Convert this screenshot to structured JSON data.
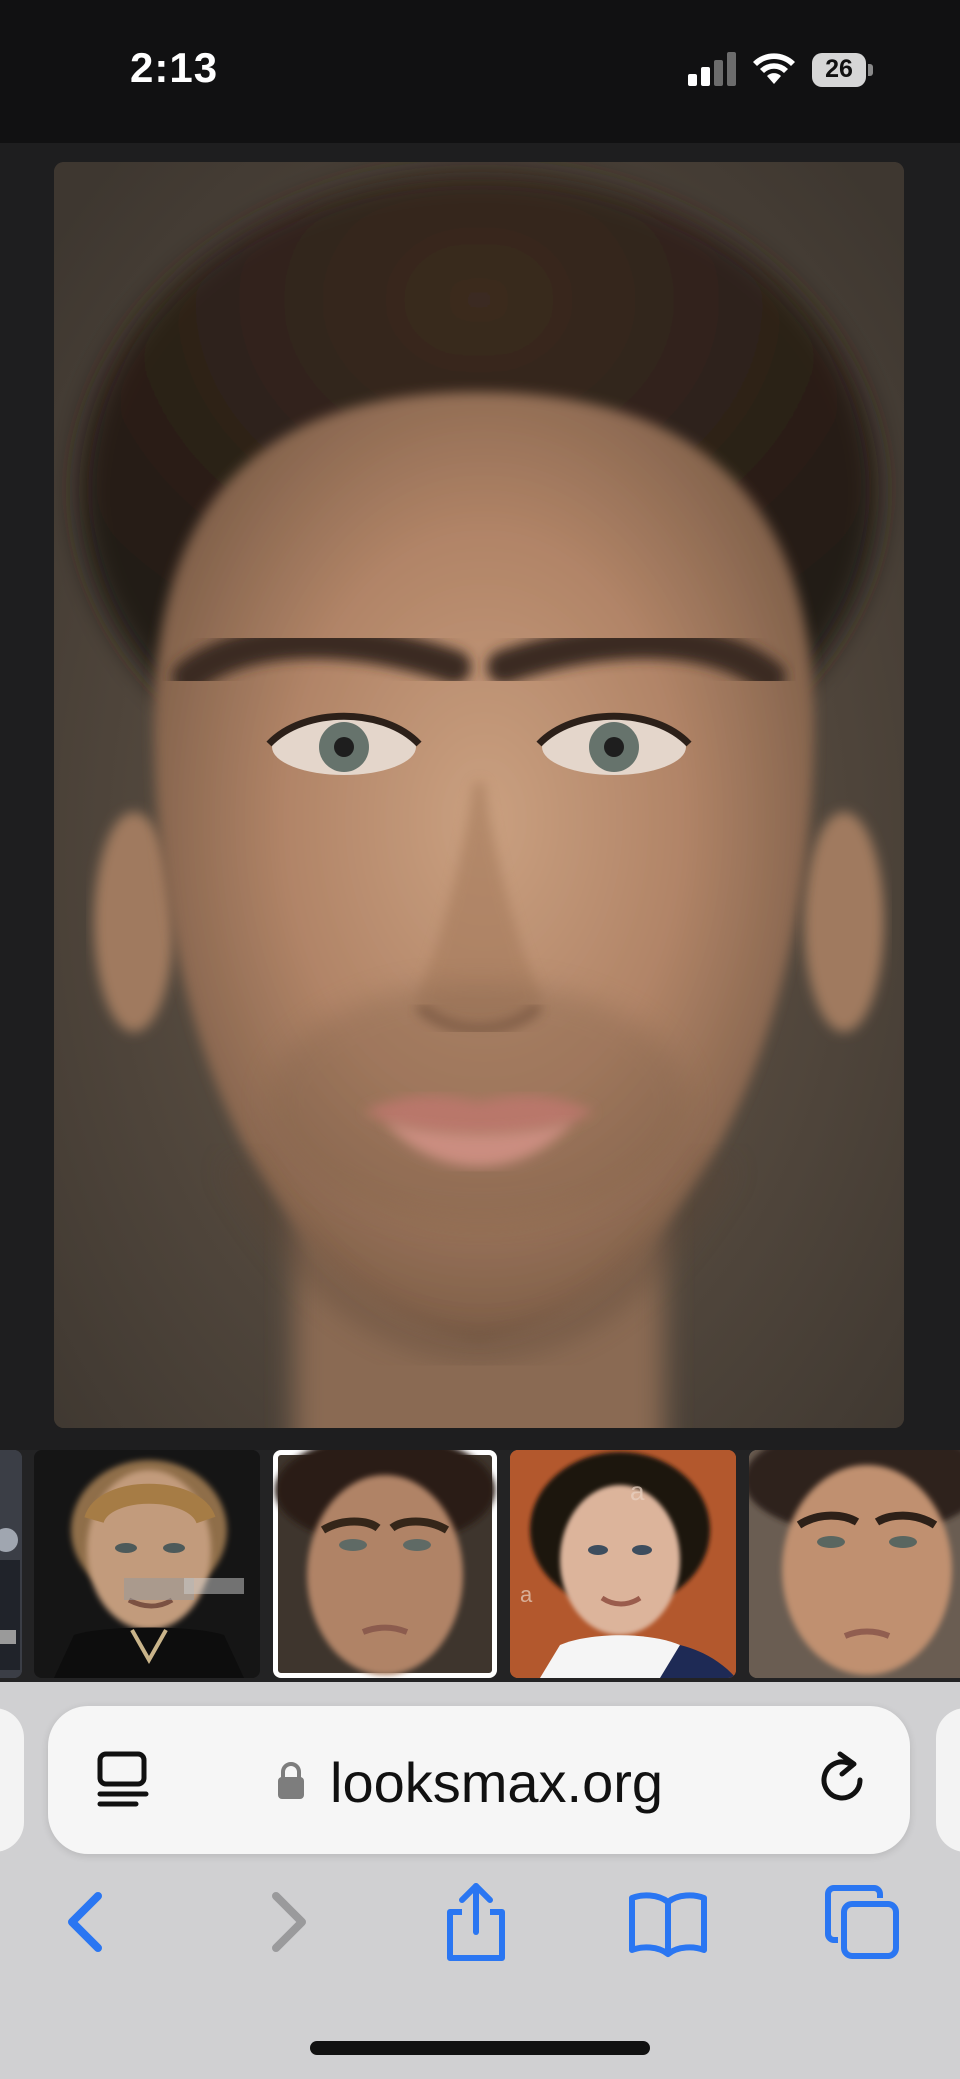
{
  "status": {
    "time": "2:13",
    "battery": "26"
  },
  "browser": {
    "url": "looksmax.org",
    "accent_color": "#2a76f2"
  },
  "thumbnails": [
    {
      "name": "partial-photo"
    },
    {
      "name": "celebrity-photo",
      "watermark": "gettyimages"
    },
    {
      "name": "composite-face",
      "selected": true
    },
    {
      "name": "young-man-photo",
      "watermark": "a"
    },
    {
      "name": "composite-face-2"
    }
  ]
}
